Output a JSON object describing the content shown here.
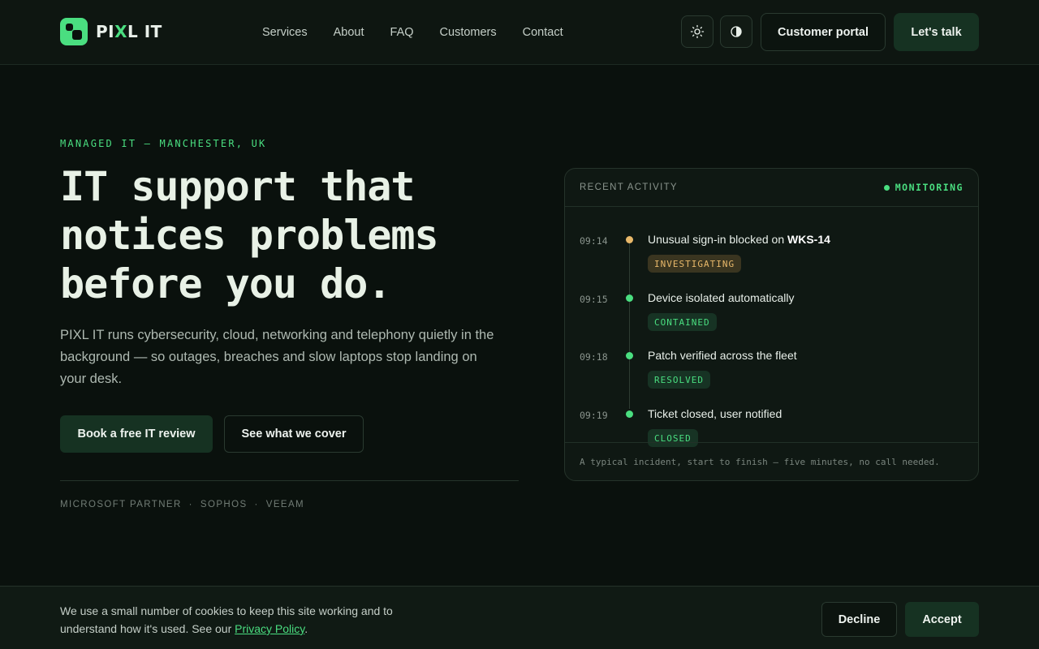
{
  "header": {
    "logo_parts": [
      "PI",
      "X",
      "L IT"
    ],
    "nav": [
      "Services",
      "About",
      "FAQ",
      "Customers",
      "Contact"
    ],
    "light_theme_icon": "sun-icon",
    "contrast_icon": "contrast-icon",
    "portal_label": "Customer portal",
    "talk_label": "Let's talk"
  },
  "hero": {
    "eyebrow": "MANAGED IT — MANCHESTER, UK",
    "headline_lines": [
      "IT support that",
      "notices problems",
      "before you do."
    ],
    "lede": "PIXL IT runs cybersecurity, cloud, networking and telephony quietly in the background — so outages, breaches and slow laptops stop landing on your desk.",
    "cta_primary": "Book a free IT review",
    "cta_secondary": "See what we cover",
    "partners": [
      "MICROSOFT PARTNER",
      "·",
      "SOPHOS",
      "·",
      "VEEAM"
    ]
  },
  "activity": {
    "title": "RECENT ACTIVITY",
    "status": "MONITORING",
    "events": [
      {
        "time": "09:14",
        "text": "Unusual sign-in blocked on",
        "emphasis": "WKS-14",
        "badge": "INVESTIGATING",
        "dot_color": "#e8b86a",
        "badge_color": "#e8b86a",
        "badge_bg": "#3a3520"
      },
      {
        "time": "09:15",
        "text": "Device isolated automatically",
        "emphasis": "",
        "badge": "CONTAINED",
        "dot_color": "#4ade80",
        "badge_color": "#4ade80",
        "badge_bg": "#173324"
      },
      {
        "time": "09:18",
        "text": "Patch verified across the fleet",
        "emphasis": "",
        "badge": "RESOLVED",
        "dot_color": "#4ade80",
        "badge_color": "#4ade80",
        "badge_bg": "#173324"
      },
      {
        "time": "09:19",
        "text": "Ticket closed, user notified",
        "emphasis": "",
        "badge": "CLOSED",
        "dot_color": "#4ade80",
        "badge_color": "#4ade80",
        "badge_bg": "#173324"
      }
    ],
    "footer": "A typical incident, start to finish — five minutes, no call needed."
  },
  "cookie": {
    "text": "We use a small number of cookies to keep this site working and to understand how it's used. See our ",
    "link": "Privacy Policy",
    "suffix": ".",
    "decline": "Decline",
    "accept": "Accept"
  },
  "colors": {
    "accent": "#4ade80",
    "background": "#0a110d",
    "button_dark": "#163222"
  }
}
